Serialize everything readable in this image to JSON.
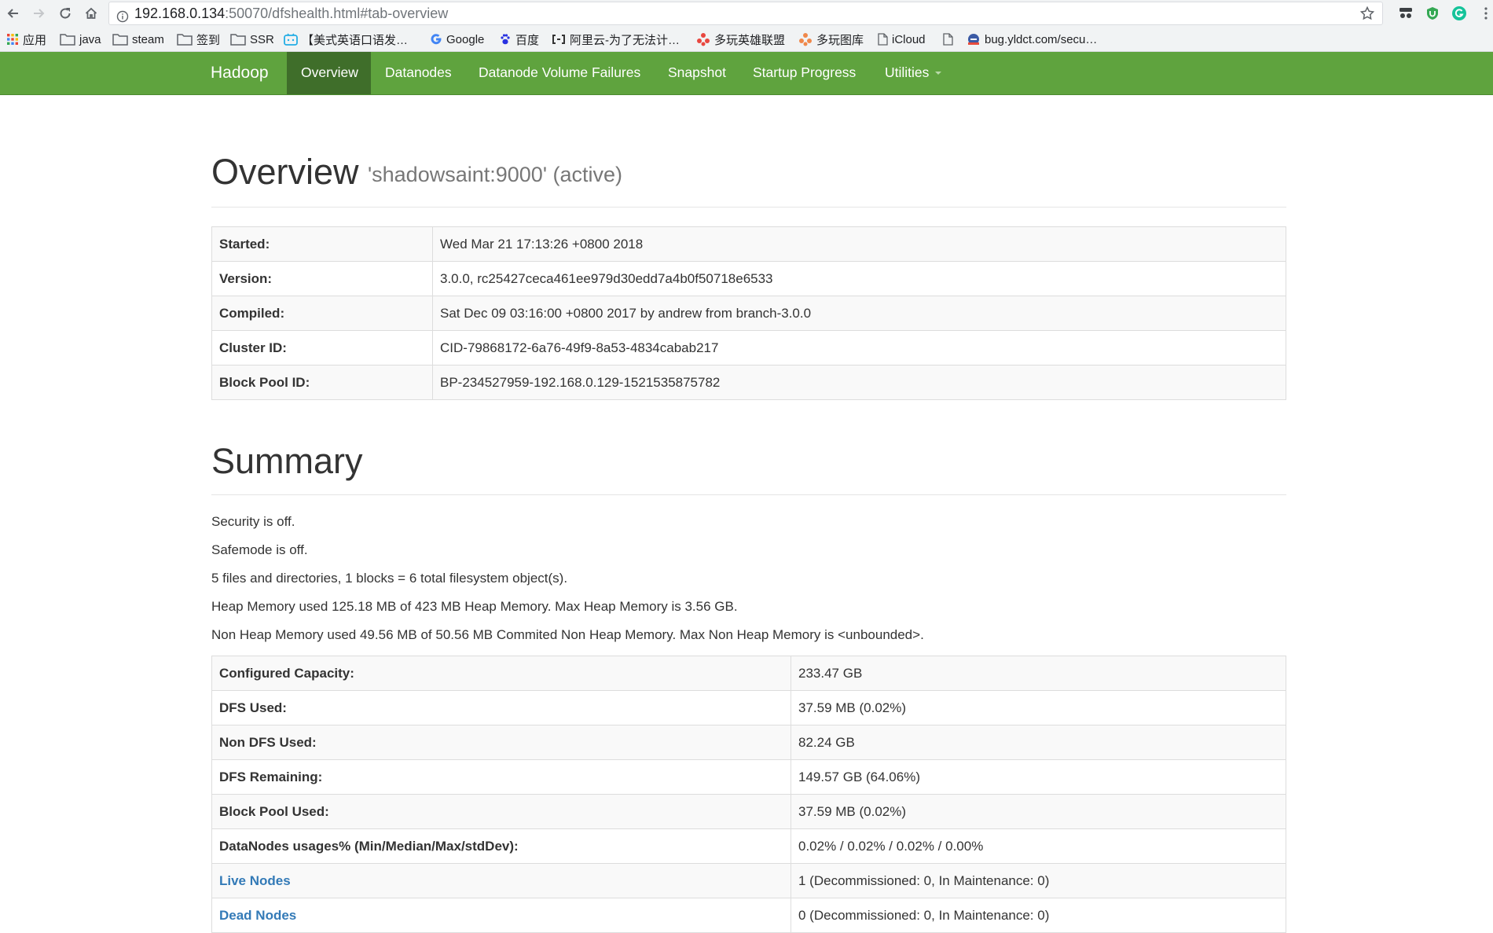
{
  "browser": {
    "url_host": "192.168.0.134",
    "url_path": ":50070/dfshealth.html#tab-overview",
    "bookmarks": [
      "应用",
      "java",
      "steam",
      "签到",
      "SSR",
      "【美式英语口语发…",
      "Google",
      "百度",
      "阿里云-为了无法计…",
      "多玩英雄联盟",
      "多玩图库",
      "iCloud",
      "bug.yldct.com/secu…"
    ]
  },
  "navbar": {
    "brand": "Hadoop",
    "items": [
      "Overview",
      "Datanodes",
      "Datanode Volume Failures",
      "Snapshot",
      "Startup Progress",
      "Utilities"
    ],
    "active": "Overview"
  },
  "overview": {
    "title": "Overview",
    "subtitle": "'shadowsaint:9000' (active)",
    "rows": [
      {
        "key": "Started:",
        "value": "Wed Mar 21 17:13:26 +0800 2018"
      },
      {
        "key": "Version:",
        "value": "3.0.0, rc25427ceca461ee979d30edd7a4b0f50718e6533"
      },
      {
        "key": "Compiled:",
        "value": "Sat Dec 09 03:16:00 +0800 2017 by andrew from branch-3.0.0"
      },
      {
        "key": "Cluster ID:",
        "value": "CID-79868172-6a76-49f9-8a53-4834cabab217"
      },
      {
        "key": "Block Pool ID:",
        "value": "BP-234527959-192.168.0.129-1521535875782"
      }
    ]
  },
  "summary": {
    "title": "Summary",
    "lines": [
      "Security is off.",
      "Safemode is off.",
      "5 files and directories, 1 blocks = 6 total filesystem object(s).",
      "Heap Memory used 125.18 MB of 423 MB Heap Memory. Max Heap Memory is 3.56 GB.",
      "Non Heap Memory used 49.56 MB of 50.56 MB Commited Non Heap Memory. Max Non Heap Memory is <unbounded>."
    ],
    "rows": [
      {
        "key": "Configured Capacity:",
        "value": "233.47 GB"
      },
      {
        "key": "DFS Used:",
        "value": "37.59 MB (0.02%)"
      },
      {
        "key": "Non DFS Used:",
        "value": "82.24 GB"
      },
      {
        "key": "DFS Remaining:",
        "value": "149.57 GB (64.06%)"
      },
      {
        "key": "Block Pool Used:",
        "value": "37.59 MB (0.02%)"
      },
      {
        "key": "DataNodes usages% (Min/Median/Max/stdDev):",
        "value": "0.02% / 0.02% / 0.02% / 0.00%"
      },
      {
        "key": "Live Nodes",
        "value": "1 (Decommissioned: 0, In Maintenance: 0)"
      },
      {
        "key": "Dead Nodes",
        "value": "0 (Decommissioned: 0, In Maintenance: 0)"
      }
    ]
  }
}
